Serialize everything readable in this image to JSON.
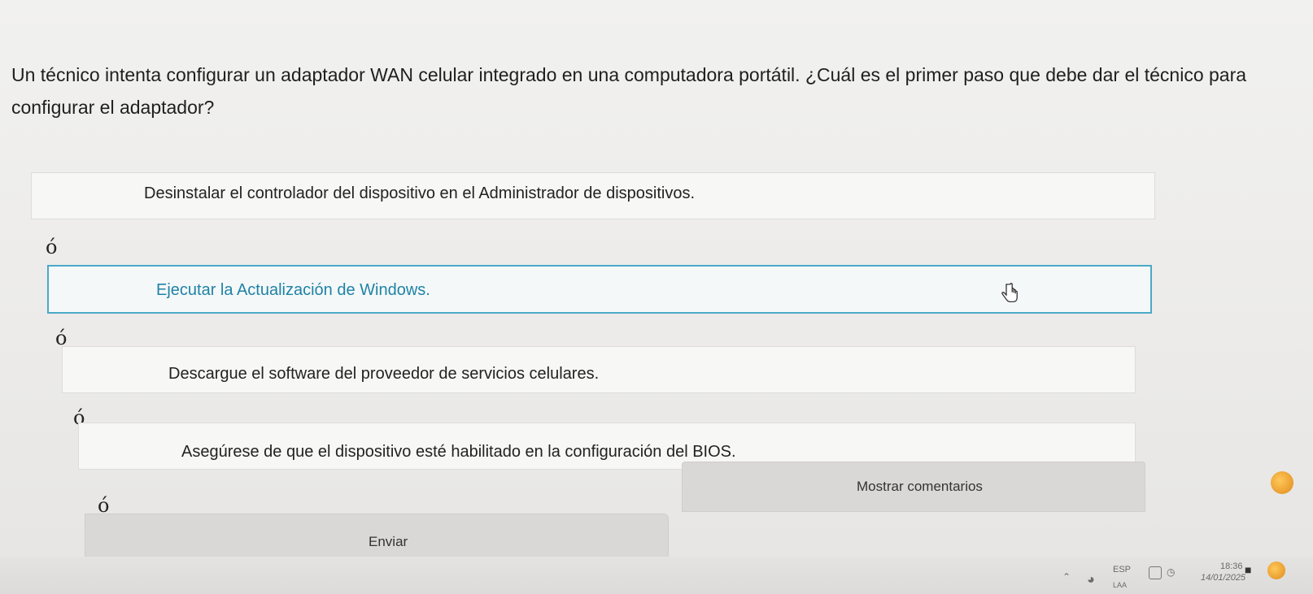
{
  "question": {
    "text": "Un técnico intenta configurar un adaptador WAN celular integrado en una computadora portátil. ¿Cuál es el primer paso que debe dar el técnico para configurar el adaptador?"
  },
  "options": [
    {
      "label": "Desinstalar el controlador del dispositivo en el Administrador de dispositivos.",
      "selected": false
    },
    {
      "label": "Ejecutar la Actualización de Windows.",
      "selected": true
    },
    {
      "label": "Descargue el software del proveedor de servicios celulares.",
      "selected": false
    },
    {
      "label": "Asegúrese de que el dispositivo esté habilitado en la configuración del BIOS.",
      "selected": false
    }
  ],
  "separators": [
    "ó",
    "ó",
    "ó",
    "ó"
  ],
  "buttons": {
    "submit_label": "Enviar",
    "feedback_label": "Mostrar comentarios"
  },
  "taskbar": {
    "language": "ESP",
    "language_sub": "LAA",
    "time": "18:36",
    "date": "14/01/2025",
    "icons": [
      "chevron-up-icon",
      "wifi-icon",
      "speaker-icon",
      "battery-icon",
      "notification-icon"
    ]
  },
  "colors": {
    "selected_border": "#4aa9c7",
    "selected_text": "#1e83a6",
    "avatar": "#f0a024"
  }
}
